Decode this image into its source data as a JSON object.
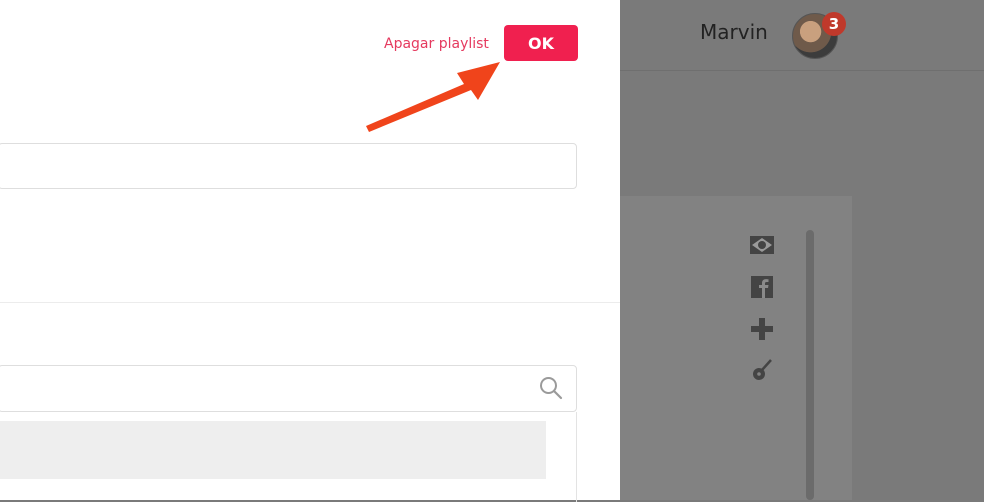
{
  "header": {
    "user_name": "Marvin",
    "notification_count": "3"
  },
  "modal": {
    "delete_label": "Apagar playlist",
    "ok_label": "OK",
    "name_field": {
      "value": "",
      "placeholder": ""
    },
    "search_field": {
      "value": "",
      "placeholder": ""
    }
  },
  "sidebar_icons": [
    "brazil-flag-icon",
    "facebook-icon",
    "plus-icon",
    "guitar-icon"
  ],
  "colors": {
    "accent": "#f0204f",
    "link": "#e53a5f",
    "overlay": "#7a7a7a",
    "badge": "#c0392b",
    "arrow": "#f0441b"
  }
}
